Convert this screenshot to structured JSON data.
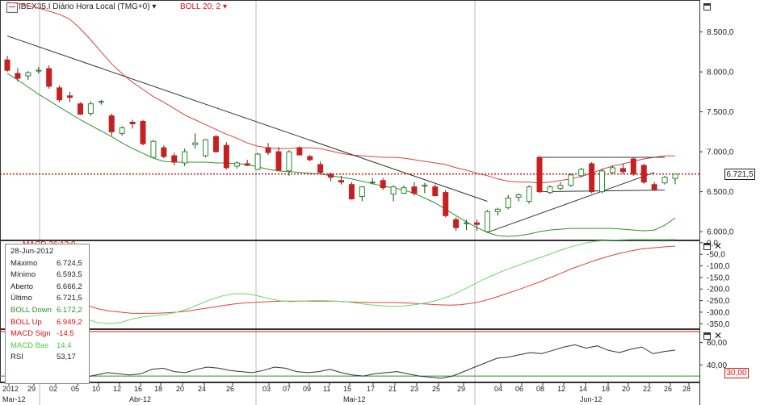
{
  "header": {
    "symbol_label": "IBEX35.I Diário Hora Local (TMG+0)",
    "dropdown_arrow": "▾",
    "indicator_label": "BOLL 20; 2",
    "indicator_arrow": "▾"
  },
  "colors": {
    "up_candle": "#2a8a2a",
    "down_candle": "#c62020",
    "boll_up": "#e04040",
    "boll_down": "#2f8f2f",
    "trendline": "#333333",
    "macd_sign": "#e04040",
    "macd_bas": "#66dd66",
    "rsi": "#333333",
    "current_price": "#cc0000"
  },
  "price_axis": [
    "8.500,0",
    "8.000,0",
    "7.500,0",
    "7.000,0",
    "6.500,0",
    "6.000,0"
  ],
  "current_price_tag": "6.721,5",
  "macd_axis": [
    "0,0",
    "-50,0",
    "-100,0",
    "-150,0",
    "-200,0",
    "-250,0",
    "-300,0",
    "-350,0"
  ],
  "rsi_axis": [
    "60,00",
    "40,00"
  ],
  "rsi_tag": "30,00",
  "macd_legend_partial": "MACD 26;12;9",
  "info_panel": {
    "date": "28-Jun-2012",
    "rows": [
      {
        "label": "Máximo",
        "value": "6.724,5",
        "color": "#222222"
      },
      {
        "label": "Mínimo",
        "value": "6.593,5",
        "color": "#222222"
      },
      {
        "label": "Aberto",
        "value": "6.666,2",
        "color": "#222222"
      },
      {
        "label": "Último",
        "value": "6.721,5",
        "color": "#222222"
      },
      {
        "label": "BOLL Down",
        "value": "6.172,2",
        "color": "#2f8f2f"
      },
      {
        "label": "BOLL Up",
        "value": "6.949,2",
        "color": "#d11111"
      },
      {
        "label": "MACD Sign",
        "value": "-14,5",
        "color": "#d11111"
      },
      {
        "label": "MACD Bas",
        "value": "14,4",
        "color": "#44cc44"
      },
      {
        "label": "RSI",
        "value": "53,17",
        "color": "#222222"
      }
    ]
  },
  "date_ticks": [
    "2012",
    "29",
    "02",
    "05",
    "10",
    "12",
    "16",
    "18",
    "20",
    "24",
    "26",
    "03",
    "07",
    "09",
    "11",
    "15",
    "17",
    "21",
    "23",
    "25",
    "29",
    "04",
    "06",
    "08",
    "12",
    "14",
    "18",
    "20",
    "22",
    "26",
    "28"
  ],
  "month_labels": [
    "Mar-12",
    "Abr-12",
    "Mai-12",
    "Jun-12"
  ],
  "chart_data": [
    {
      "type": "candlestick",
      "title": "IBEX35.I",
      "ylim": [
        5900,
        8900
      ],
      "ohlc": [
        {
          "o": 8150,
          "h": 8200,
          "l": 8000,
          "c": 8020
        },
        {
          "o": 7980,
          "h": 8050,
          "l": 7880,
          "c": 7920
        },
        {
          "o": 7950,
          "h": 8010,
          "l": 7900,
          "c": 7990
        },
        {
          "o": 8020,
          "h": 8060,
          "l": 7980,
          "c": 8020
        },
        {
          "o": 8040,
          "h": 8080,
          "l": 7790,
          "c": 7820
        },
        {
          "o": 7800,
          "h": 7830,
          "l": 7620,
          "c": 7650
        },
        {
          "o": 7700,
          "h": 7750,
          "l": 7620,
          "c": 7680
        },
        {
          "o": 7600,
          "h": 7620,
          "l": 7460,
          "c": 7470
        },
        {
          "o": 7480,
          "h": 7630,
          "l": 7450,
          "c": 7600
        },
        {
          "o": 7620,
          "h": 7650,
          "l": 7590,
          "c": 7630
        },
        {
          "o": 7450,
          "h": 7480,
          "l": 7200,
          "c": 7250
        },
        {
          "o": 7230,
          "h": 7320,
          "l": 7200,
          "c": 7300
        },
        {
          "o": 7370,
          "h": 7400,
          "l": 7290,
          "c": 7350
        },
        {
          "o": 7380,
          "h": 7400,
          "l": 7080,
          "c": 7100
        },
        {
          "o": 6930,
          "h": 7150,
          "l": 6930,
          "c": 7130
        },
        {
          "o": 7050,
          "h": 7080,
          "l": 6920,
          "c": 6940
        },
        {
          "o": 6950,
          "h": 6990,
          "l": 6830,
          "c": 6870
        },
        {
          "o": 6860,
          "h": 7040,
          "l": 6820,
          "c": 7000
        },
        {
          "o": 7090,
          "h": 7230,
          "l": 7040,
          "c": 7110
        },
        {
          "o": 6950,
          "h": 7160,
          "l": 6930,
          "c": 7150
        },
        {
          "o": 7190,
          "h": 7210,
          "l": 6990,
          "c": 7000
        },
        {
          "o": 7080,
          "h": 7120,
          "l": 6780,
          "c": 6800
        },
        {
          "o": 6820,
          "h": 6880,
          "l": 6790,
          "c": 6860
        },
        {
          "o": 6850,
          "h": 6900,
          "l": 6820,
          "c": 6830
        },
        {
          "o": 6780,
          "h": 6990,
          "l": 6770,
          "c": 6970
        },
        {
          "o": 7050,
          "h": 7110,
          "l": 6960,
          "c": 6990
        },
        {
          "o": 7000,
          "h": 7060,
          "l": 6760,
          "c": 6770
        },
        {
          "o": 6760,
          "h": 7020,
          "l": 6700,
          "c": 7000
        },
        {
          "o": 7050,
          "h": 7070,
          "l": 6960,
          "c": 6960
        },
        {
          "o": 6940,
          "h": 6960,
          "l": 6880,
          "c": 6900
        },
        {
          "o": 6840,
          "h": 6880,
          "l": 6720,
          "c": 6740
        },
        {
          "o": 6720,
          "h": 6740,
          "l": 6630,
          "c": 6680
        },
        {
          "o": 6640,
          "h": 6700,
          "l": 6590,
          "c": 6620
        },
        {
          "o": 6590,
          "h": 6620,
          "l": 6400,
          "c": 6410
        },
        {
          "o": 6440,
          "h": 6570,
          "l": 6380,
          "c": 6560
        },
        {
          "o": 6620,
          "h": 6670,
          "l": 6590,
          "c": 6620
        },
        {
          "o": 6640,
          "h": 6670,
          "l": 6520,
          "c": 6550
        },
        {
          "o": 6470,
          "h": 6580,
          "l": 6380,
          "c": 6560
        },
        {
          "o": 6480,
          "h": 6580,
          "l": 6470,
          "c": 6550
        },
        {
          "o": 6560,
          "h": 6620,
          "l": 6450,
          "c": 6480
        },
        {
          "o": 6570,
          "h": 6610,
          "l": 6480,
          "c": 6580
        },
        {
          "o": 6560,
          "h": 6590,
          "l": 6440,
          "c": 6450
        },
        {
          "o": 6490,
          "h": 6520,
          "l": 6180,
          "c": 6200
        },
        {
          "o": 6150,
          "h": 6180,
          "l": 6010,
          "c": 6050
        },
        {
          "o": 6100,
          "h": 6150,
          "l": 6020,
          "c": 6110
        },
        {
          "o": 6110,
          "h": 6150,
          "l": 6010,
          "c": 6090
        },
        {
          "o": 6000,
          "h": 6270,
          "l": 5990,
          "c": 6250
        },
        {
          "o": 6250,
          "h": 6300,
          "l": 6200,
          "c": 6280
        },
        {
          "o": 6300,
          "h": 6460,
          "l": 6280,
          "c": 6420
        },
        {
          "o": 6430,
          "h": 6480,
          "l": 6380,
          "c": 6460
        },
        {
          "o": 6380,
          "h": 6580,
          "l": 6350,
          "c": 6560
        },
        {
          "o": 6930,
          "h": 6950,
          "l": 6480,
          "c": 6500
        },
        {
          "o": 6490,
          "h": 6580,
          "l": 6470,
          "c": 6560
        },
        {
          "o": 6540,
          "h": 6620,
          "l": 6520,
          "c": 6580
        },
        {
          "o": 6580,
          "h": 6730,
          "l": 6560,
          "c": 6710
        },
        {
          "o": 6700,
          "h": 6800,
          "l": 6680,
          "c": 6780
        },
        {
          "o": 6850,
          "h": 6870,
          "l": 6480,
          "c": 6500
        },
        {
          "o": 6500,
          "h": 6790,
          "l": 6480,
          "c": 6760
        },
        {
          "o": 6740,
          "h": 6830,
          "l": 6720,
          "c": 6800
        },
        {
          "o": 6790,
          "h": 6850,
          "l": 6720,
          "c": 6750
        },
        {
          "o": 6910,
          "h": 6930,
          "l": 6700,
          "c": 6720
        },
        {
          "o": 6830,
          "h": 6850,
          "l": 6600,
          "c": 6620
        },
        {
          "o": 6590,
          "h": 6620,
          "l": 6510,
          "c": 6530
        },
        {
          "o": 6610,
          "h": 6700,
          "l": 6590,
          "c": 6680
        },
        {
          "o": 6666,
          "h": 6724,
          "l": 6593,
          "c": 6721
        }
      ],
      "boll_up": [
        8870,
        8860,
        8830,
        8800,
        8760,
        8720,
        8660,
        8540,
        8400,
        8250,
        8100,
        7980,
        7870,
        7780,
        7690,
        7620,
        7540,
        7460,
        7400,
        7340,
        7280,
        7220,
        7170,
        7110,
        7070,
        7050,
        7040,
        7040,
        7050,
        7050,
        7040,
        7010,
        6980,
        6960,
        6950,
        6940,
        6930,
        6930,
        6920,
        6900,
        6880,
        6860,
        6840,
        6800,
        6770,
        6730,
        6700,
        6660,
        6630,
        6620,
        6620,
        6610,
        6620,
        6640,
        6660,
        6690,
        6730,
        6780,
        6820,
        6850,
        6880,
        6910,
        6930,
        6950,
        6949
      ],
      "boll_down": [
        7980,
        7900,
        7810,
        7720,
        7640,
        7560,
        7480,
        7400,
        7330,
        7260,
        7190,
        7110,
        7040,
        6980,
        6920,
        6880,
        6870,
        6870,
        6870,
        6870,
        6860,
        6860,
        6850,
        6840,
        6810,
        6780,
        6760,
        6750,
        6740,
        6730,
        6720,
        6700,
        6680,
        6660,
        6630,
        6600,
        6570,
        6550,
        6520,
        6480,
        6420,
        6360,
        6280,
        6200,
        6120,
        6050,
        5990,
        5950,
        5940,
        5950,
        5970,
        6000,
        6020,
        6030,
        6040,
        6040,
        6040,
        6040,
        6040,
        6030,
        6020,
        6010,
        6020,
        6080,
        6172
      ],
      "trendlines": [
        {
          "x1": 0,
          "y1": 8450,
          "x2": 46,
          "y2": 6380
        },
        {
          "x1": 46,
          "y1": 5990,
          "x2": 62,
          "y2": 6740
        },
        {
          "x1": 51,
          "y1": 6930,
          "x2": 63,
          "y2": 6930
        },
        {
          "x1": 51,
          "y1": 6500,
          "x2": 63,
          "y2": 6520
        }
      ],
      "current_price": 6721.5
    },
    {
      "type": "line",
      "title": "MACD",
      "ylim": [
        -370,
        10
      ],
      "series": [
        {
          "name": "MACD Sign",
          "values": [
            -190,
            -200,
            -210,
            -220,
            -230,
            -240,
            -255,
            -270,
            -285,
            -295,
            -300,
            -305,
            -305,
            -305,
            -303,
            -300,
            -295,
            -287,
            -280,
            -272,
            -265,
            -260,
            -257,
            -255,
            -253,
            -252,
            -252,
            -252,
            -252,
            -253,
            -255,
            -257,
            -258,
            -258,
            -258,
            -260,
            -262,
            -265,
            -268,
            -270,
            -268,
            -262,
            -252,
            -238,
            -222,
            -205,
            -188,
            -170,
            -150,
            -130,
            -110,
            -92,
            -75,
            -60,
            -47,
            -36,
            -27,
            -22,
            -18,
            -14.5
          ]
        },
        {
          "name": "MACD Bas",
          "values": [
            -180,
            -195,
            -215,
            -235,
            -260,
            -285,
            -310,
            -330,
            -345,
            -350,
            -345,
            -330,
            -320,
            -315,
            -310,
            -300,
            -285,
            -265,
            -245,
            -230,
            -220,
            -220,
            -228,
            -240,
            -250,
            -255,
            -252,
            -250,
            -250,
            -252,
            -255,
            -262,
            -268,
            -272,
            -275,
            -273,
            -268,
            -260,
            -248,
            -232,
            -210,
            -185,
            -160,
            -138,
            -118,
            -100,
            -82,
            -65,
            -48,
            -30,
            -15,
            -2,
            6,
            10,
            12,
            14,
            14.4,
            14,
            14,
            14.4
          ]
        }
      ]
    },
    {
      "type": "line",
      "title": "RSI",
      "ylim": [
        25,
        72
      ],
      "series": [
        {
          "name": "RSI",
          "values": [
            33,
            31,
            30,
            32,
            34,
            31,
            30,
            29,
            31,
            33,
            32,
            31,
            32,
            36,
            37,
            34,
            33,
            36,
            38,
            37,
            35,
            34,
            33,
            35,
            38,
            37,
            34,
            33,
            34,
            36,
            33,
            31,
            30,
            32,
            33,
            34,
            32,
            30,
            29,
            28,
            30,
            34,
            38,
            42,
            46,
            47,
            49,
            51,
            50,
            53,
            56,
            58,
            55,
            57,
            53,
            51,
            54,
            56,
            50,
            52,
            53.2
          ]
        }
      ],
      "reference_line": 30
    }
  ]
}
